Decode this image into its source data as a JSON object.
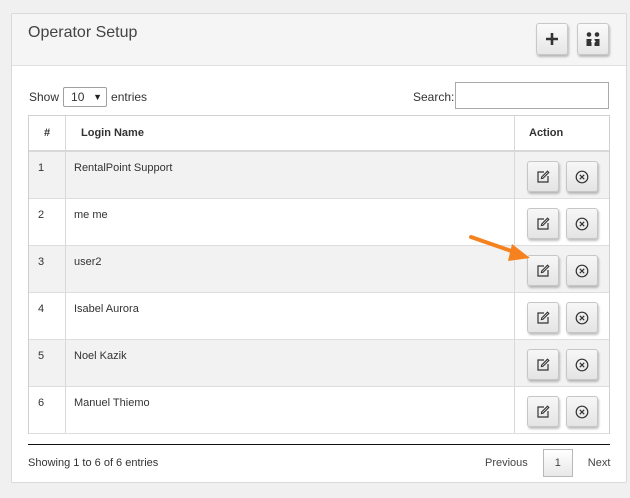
{
  "panel": {
    "title": "Operator Setup",
    "add_icon": "plus-icon",
    "assign_icon": "user-transfer-icon"
  },
  "controls": {
    "show_label": "Show",
    "page_size": "10",
    "entries_label": "entries",
    "search_label": "Search:",
    "search_value": ""
  },
  "table": {
    "headers": [
      "#",
      "Login Name",
      "Action"
    ],
    "rows": [
      {
        "num": "1",
        "login": "RentalPoint Support"
      },
      {
        "num": "2",
        "login": "me me"
      },
      {
        "num": "3",
        "login": "user2"
      },
      {
        "num": "4",
        "login": "Isabel Aurora"
      },
      {
        "num": "5",
        "login": "Noel Kazik"
      },
      {
        "num": "6",
        "login": "Manuel Thiemo"
      }
    ],
    "edit_icon": "edit-icon",
    "delete_icon": "delete-circle-icon"
  },
  "footer": {
    "info": "Showing 1 to 6 of 6 entries",
    "previous": "Previous",
    "current_page": "1",
    "next": "Next"
  },
  "colors": {
    "annotation_arrow": "#f5821f",
    "odd_row": "#f2f2f2"
  }
}
